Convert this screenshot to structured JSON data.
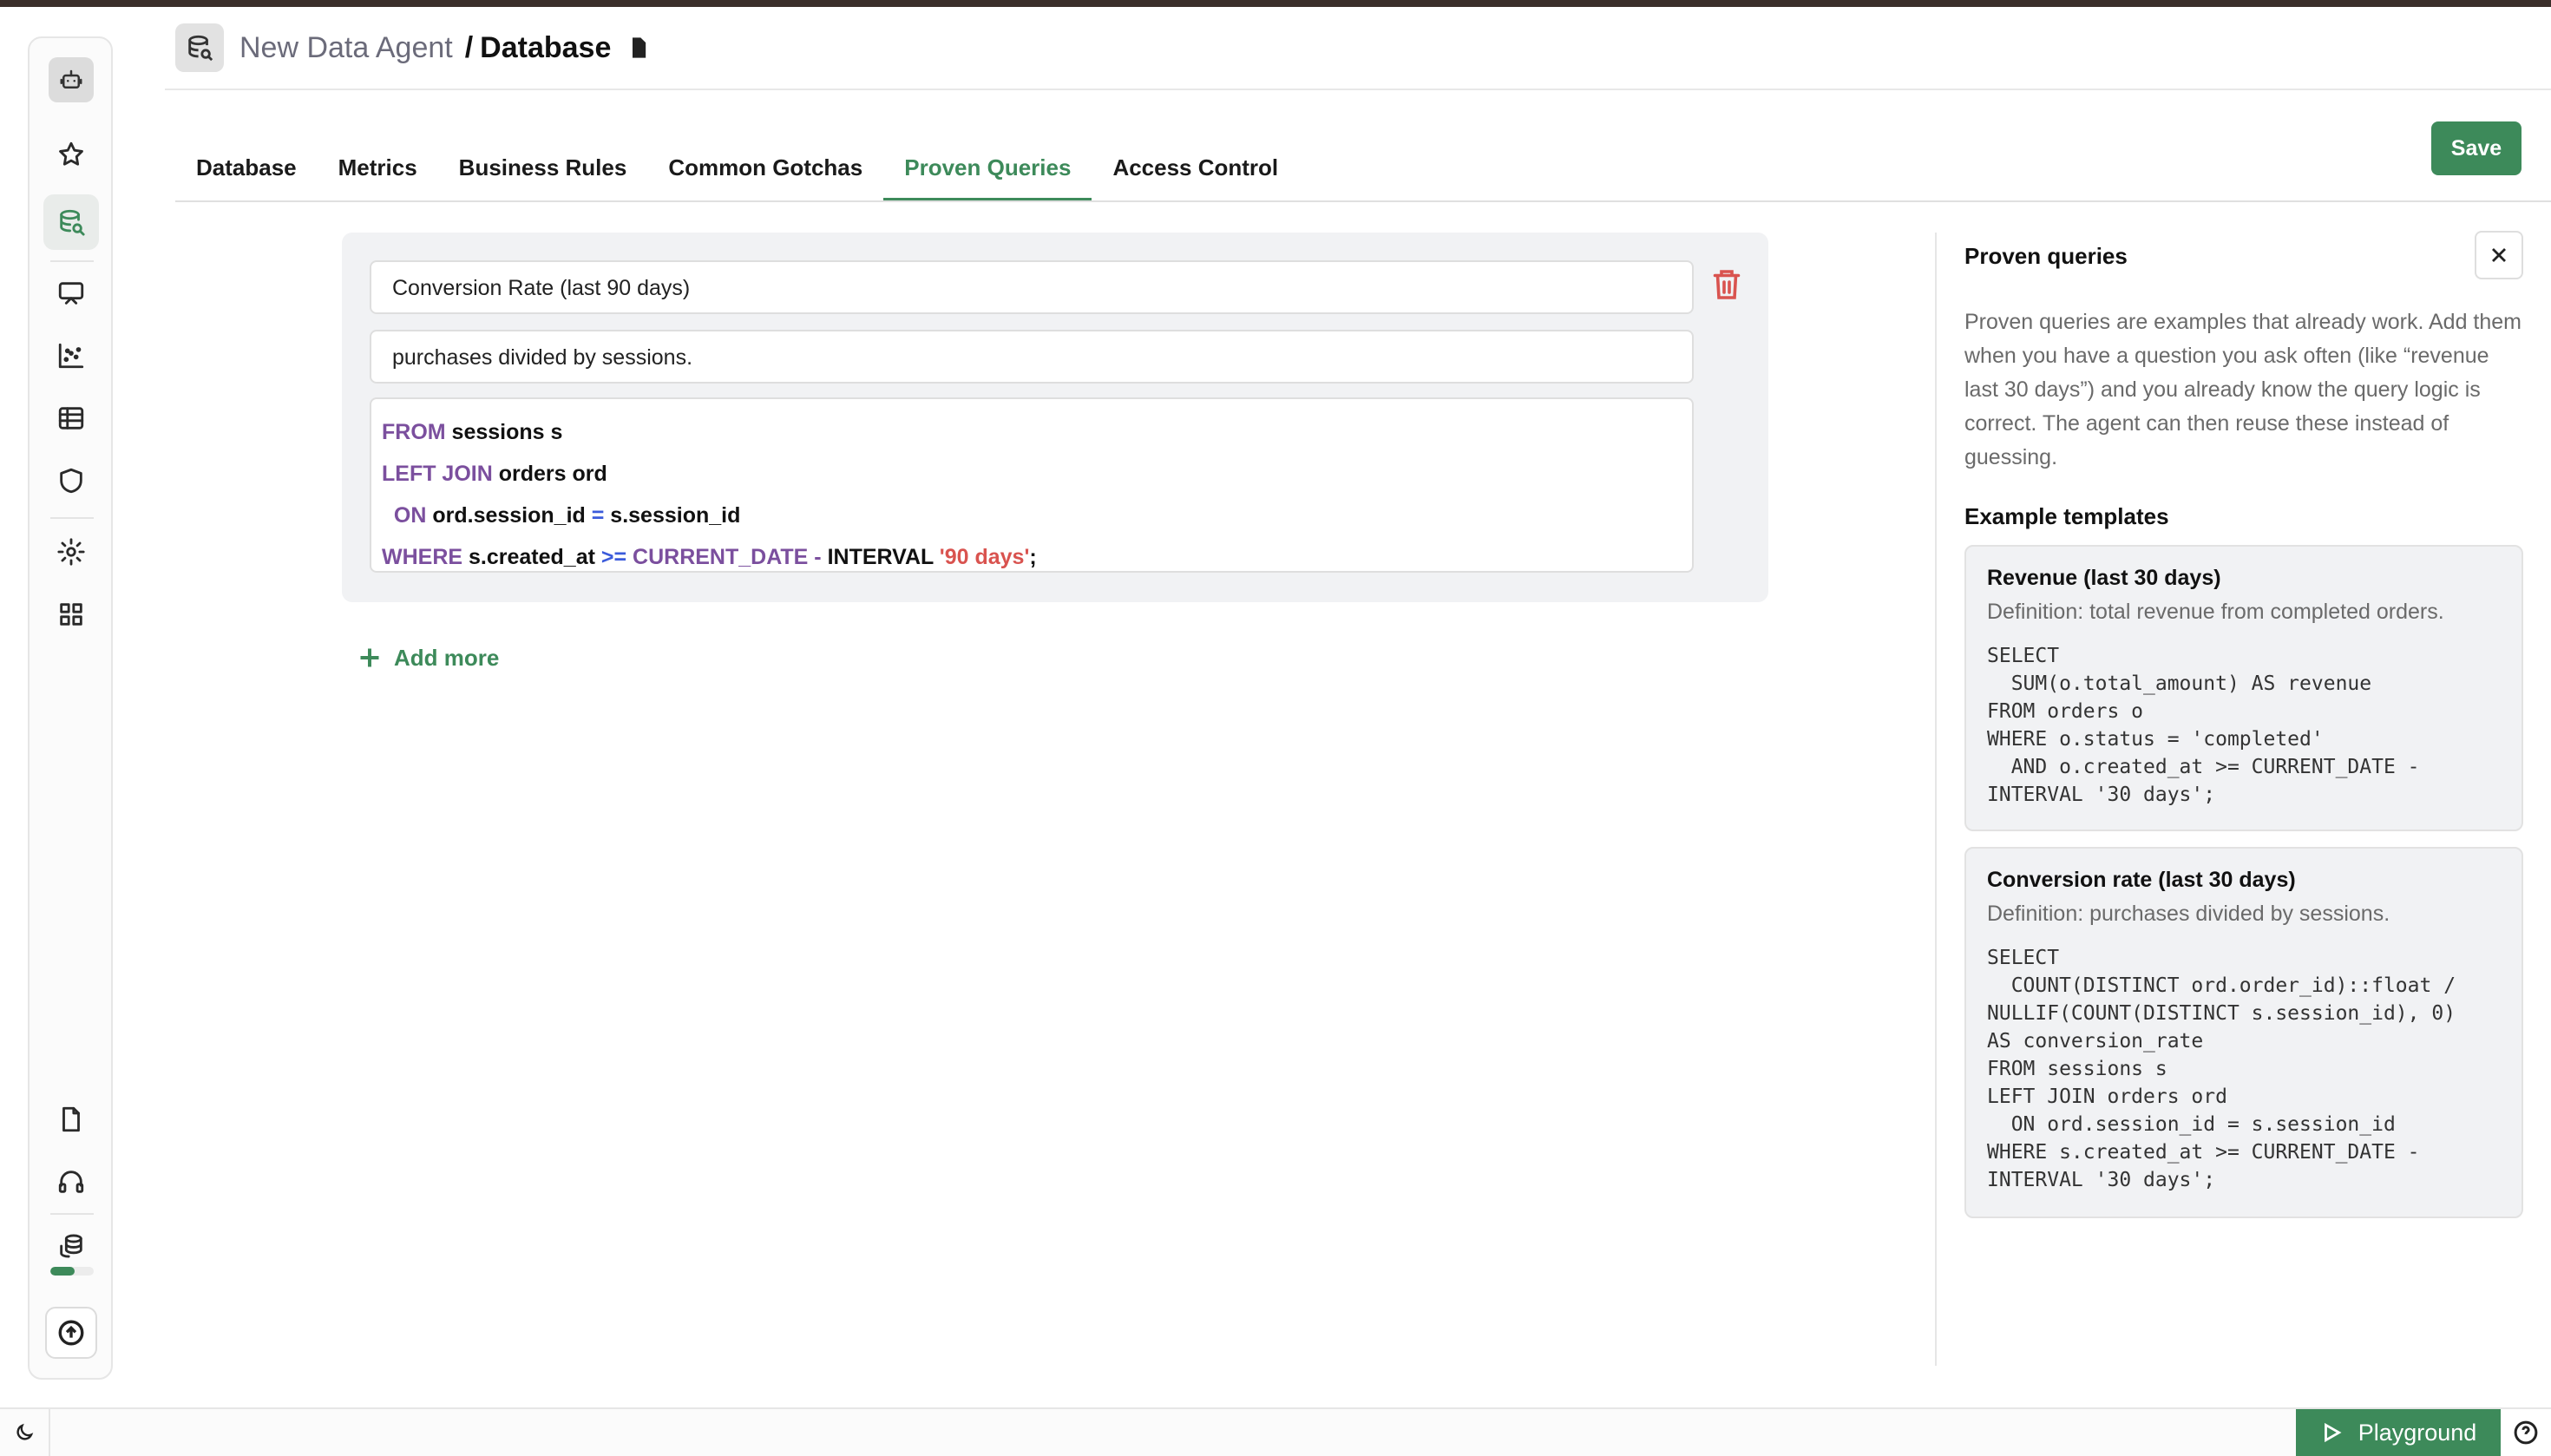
{
  "header": {
    "agent_name": "New Data Agent",
    "separator": "/",
    "section": "Database"
  },
  "tabs": [
    {
      "label": "Database",
      "active": false
    },
    {
      "label": "Metrics",
      "active": false
    },
    {
      "label": "Business Rules",
      "active": false
    },
    {
      "label": "Common Gotchas",
      "active": false
    },
    {
      "label": "Proven Queries",
      "active": true
    },
    {
      "label": "Access Control",
      "active": false
    }
  ],
  "toolbar": {
    "save_label": "Save"
  },
  "sidebar": {
    "items": [
      "robot-icon",
      "star-icon",
      "database-search-icon",
      "presentation-icon",
      "scatter-chart-icon",
      "table-icon",
      "shield-icon",
      "gear-icon",
      "grid-icon",
      "document-icon",
      "headphones-icon",
      "coins-icon",
      "upload-icon"
    ],
    "usage_fraction": 0.55
  },
  "query": {
    "name": "Conversion Rate (last 90 days)",
    "definition": "purchases divided by sessions.",
    "sql_lines": [
      [
        {
          "t": "FROM",
          "c": "kw"
        },
        {
          "t": " sessions s",
          "c": ""
        }
      ],
      [
        {
          "t": "LEFT JOIN",
          "c": "kw"
        },
        {
          "t": " orders ord",
          "c": ""
        }
      ],
      [
        {
          "t": "  ON",
          "c": "kw"
        },
        {
          "t": " ord.session_id ",
          "c": ""
        },
        {
          "t": "=",
          "c": "op"
        },
        {
          "t": " s.session_id",
          "c": ""
        }
      ],
      [
        {
          "t": "WHERE",
          "c": "kw"
        },
        {
          "t": " s.created_at ",
          "c": ""
        },
        {
          "t": ">=",
          "c": "op"
        },
        {
          "t": " CURRENT_DATE -",
          "c": "kw"
        },
        {
          "t": " INTERVAL ",
          "c": ""
        },
        {
          "t": "'90 days'",
          "c": "str"
        },
        {
          "t": ";",
          "c": ""
        }
      ]
    ]
  },
  "add_more_label": "Add more",
  "panel": {
    "title": "Proven queries",
    "description": "Proven queries are examples that already work. Add them when you have a question you ask often (like “revenue last 30 days”) and you already know the query logic is correct. The agent can then reuse these instead of guessing.",
    "examples_title": "Example templates",
    "templates": [
      {
        "title": "Revenue (last 30 days)",
        "definition": "Definition: total revenue from completed orders.",
        "code": "SELECT\n  SUM(o.total_amount) AS revenue\nFROM orders o\nWHERE o.status = 'completed'\n  AND o.created_at >= CURRENT_DATE -\nINTERVAL '30 days';"
      },
      {
        "title": "Conversion rate (last 30 days)",
        "definition": "Definition: purchases divided by sessions.",
        "code": "SELECT\n  COUNT(DISTINCT ord.order_id)::float /\nNULLIF(COUNT(DISTINCT s.session_id), 0)\nAS conversion_rate\nFROM sessions s\nLEFT JOIN orders ord\n  ON ord.session_id = s.session_id\nWHERE s.created_at >= CURRENT_DATE -\nINTERVAL '30 days';"
      }
    ]
  },
  "bottom_bar": {
    "playground_label": "Playground"
  },
  "colors": {
    "accent": "#3d8a5a",
    "keyword": "#7b4f9e",
    "operator": "#3b5bdb",
    "string": "#d9534f",
    "danger": "#d9534f"
  }
}
